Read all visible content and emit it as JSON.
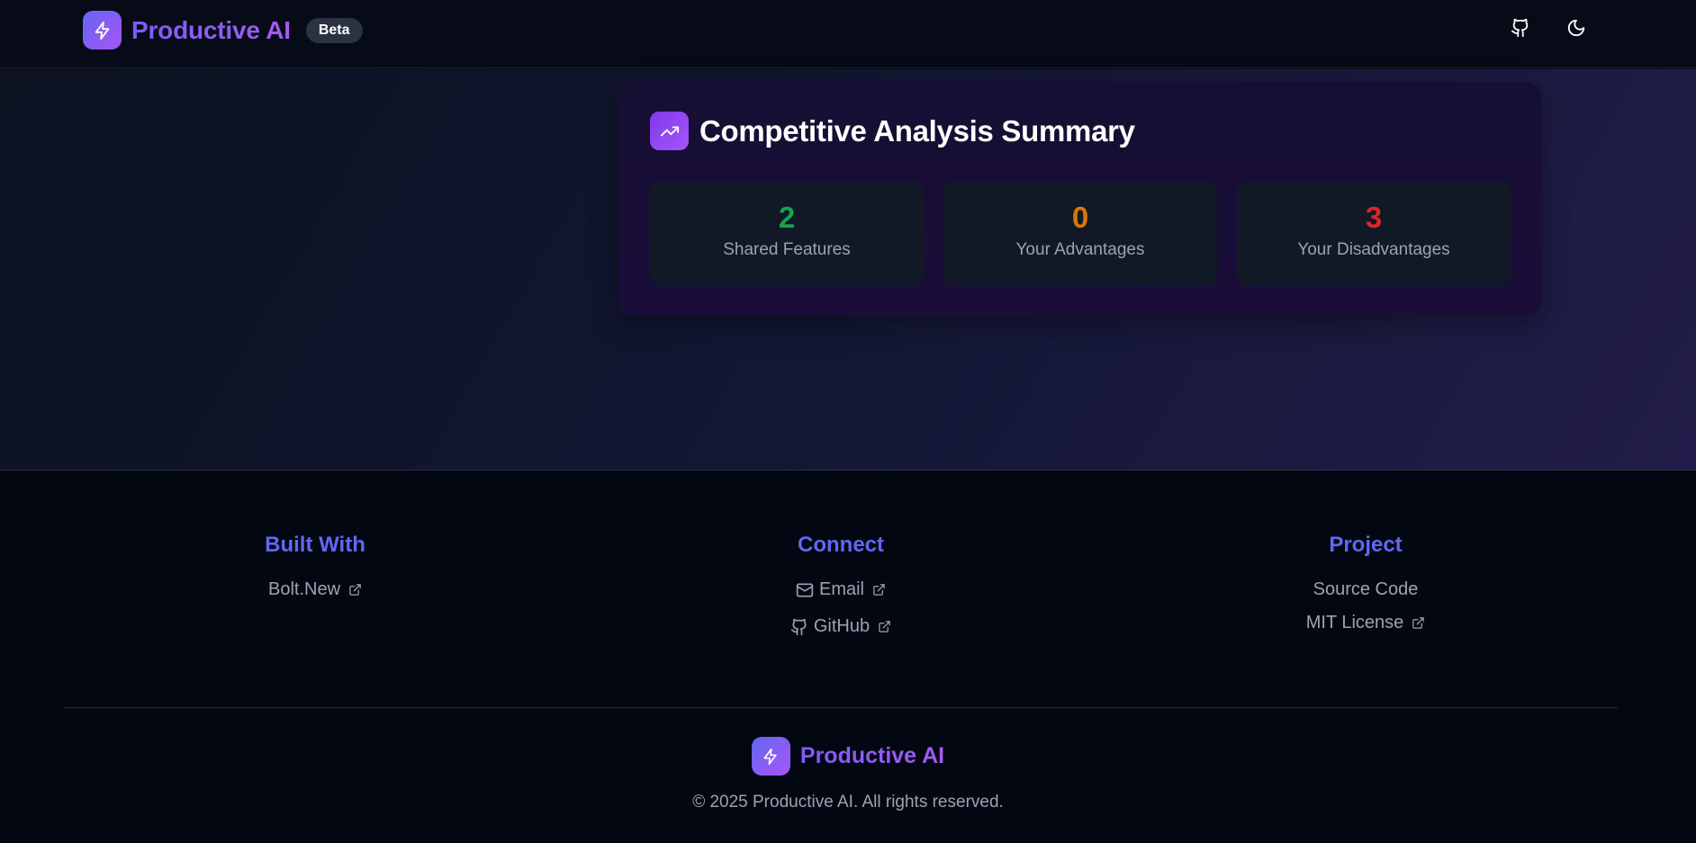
{
  "header": {
    "brand_name": "Productive AI",
    "badge": "Beta",
    "icons": [
      "lightning-icon",
      "github-icon",
      "moon-icon"
    ]
  },
  "summary": {
    "title": "Competitive Analysis Summary",
    "stats": [
      {
        "value": "2",
        "label": "Shared Features",
        "color": "#16a34a"
      },
      {
        "value": "0",
        "label": "Your Advantages",
        "color": "#d97706"
      },
      {
        "value": "3",
        "label": "Your Disadvantages",
        "color": "#dc2626"
      }
    ]
  },
  "footer": {
    "built_with": {
      "heading": "Built With",
      "links": [
        "Bolt.New"
      ]
    },
    "connect": {
      "heading": "Connect",
      "links": [
        "Email",
        "GitHub"
      ]
    },
    "project": {
      "heading": "Project",
      "links": [
        "Source Code",
        "MIT License"
      ]
    },
    "brand_name": "Productive AI",
    "copyright": "© 2025 Productive AI. All rights reserved."
  },
  "colors": {
    "accent": "#6366f1",
    "brand_gradient_start": "#6366f1",
    "brand_gradient_end": "#a855f7"
  }
}
